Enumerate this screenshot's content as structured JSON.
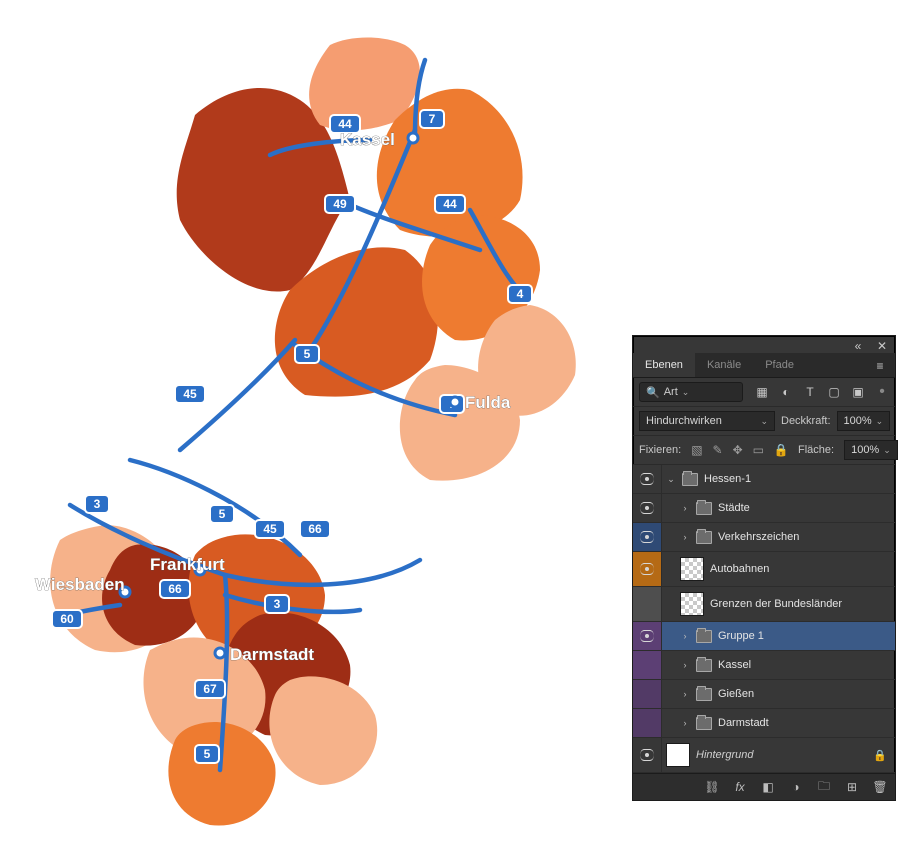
{
  "map": {
    "cities": {
      "kassel": "Kassel",
      "fulda": "Fulda",
      "frankfurt": "Frankfurt",
      "wiesbaden": "Wiesbaden",
      "darmstadt": "Darmstadt"
    },
    "signs": {
      "a44a": "44",
      "a7": "7",
      "a49": "49",
      "a44b": "44",
      "a4": "4",
      "a5a": "5",
      "a45a": "45",
      "a7b": "7",
      "a3a": "3",
      "a5b": "5",
      "a45b": "45",
      "a66a": "66",
      "a60": "60",
      "a66b": "66",
      "a3b": "3",
      "a5c": "5",
      "a67": "67"
    }
  },
  "panel": {
    "tabs": {
      "layers": "Ebenen",
      "channels": "Kanäle",
      "paths": "Pfade"
    },
    "search_prefix": "Art",
    "blend_mode": "Hindurchwirken",
    "opacity_label": "Deckkraft:",
    "opacity_value": "100%",
    "lock_label": "Fixieren:",
    "fill_label": "Fläche:",
    "fill_value": "100%",
    "layers": {
      "root": "Hessen-1",
      "cities": "Städte",
      "signs": "Verkehrszeichen",
      "highways": "Autobahnen",
      "borders": "Grenzen der Bundesländer",
      "group1": "Gruppe 1",
      "kassel": "Kassel",
      "giessen": "Gießen",
      "darmstadt": "Darmstadt",
      "bg": "Hintergrund"
    }
  }
}
